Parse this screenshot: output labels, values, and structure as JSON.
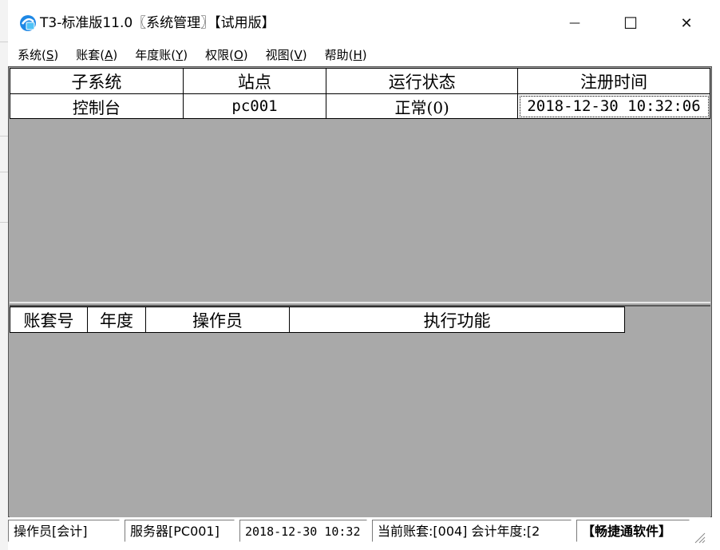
{
  "window": {
    "title": "T3-标准版11.0〖系统管理〗【试用版】",
    "controls": {
      "minimize": "—",
      "maximize": "☐",
      "close": "✕"
    }
  },
  "menu": [
    {
      "label": "系统(",
      "mnemonic": "S",
      "suffix": ")"
    },
    {
      "label": "账套(",
      "mnemonic": "A",
      "suffix": ")"
    },
    {
      "label": "年度账(",
      "mnemonic": "Y",
      "suffix": ")"
    },
    {
      "label": "权限(",
      "mnemonic": "O",
      "suffix": ")"
    },
    {
      "label": "视图(",
      "mnemonic": "V",
      "suffix": ")"
    },
    {
      "label": "帮助(",
      "mnemonic": "H",
      "suffix": ")"
    }
  ],
  "subsystem_table": {
    "columns": [
      "子系统",
      "站点",
      "运行状态",
      "注册时间"
    ],
    "rows": [
      [
        "控制台",
        "pc001",
        "正常(0)",
        "2018-12-30 10:32:06"
      ]
    ]
  },
  "task_table": {
    "columns": [
      "账套号",
      "年度",
      "操作员",
      "执行功能"
    ]
  },
  "status": {
    "operator": "操作员[会计]",
    "server": "服务器[PC001]",
    "datetime": "2018-12-30 10:32",
    "account": "当前账套:[004] 会计年度:[2",
    "brand": "【畅捷通软件】"
  },
  "colors": {
    "client_bg": "#a9a9a9",
    "grid_bg": "#ffffff",
    "accent_icon": "#1e88e5"
  }
}
